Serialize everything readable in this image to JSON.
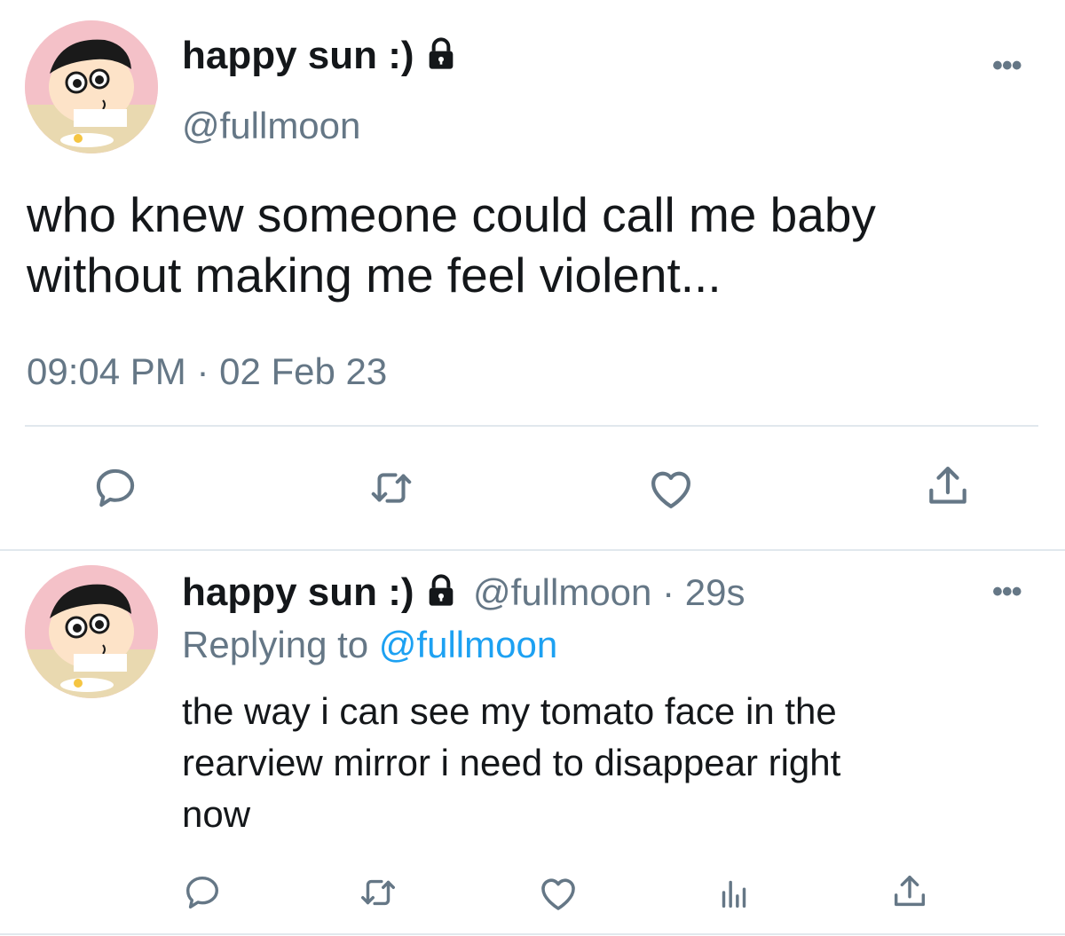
{
  "tweet": {
    "author_name": "happy sun :)",
    "handle": "@fullmoon",
    "text_line1": "who knew someone could call me baby",
    "text_line2": "without making me feel violent...",
    "timestamp": "09:04 PM · 02 Feb 23",
    "more_label": "•••"
  },
  "reply": {
    "author_name": "happy sun :)",
    "handle_time": "@fullmoon · 29s",
    "replying_prefix": "Replying to",
    "replying_to": "@fullmoon",
    "text_line1": "the way i can see my tomato face in the",
    "text_line2": "rearview mirror i need to disappear right",
    "text_line3": "now",
    "more_label": "•••"
  },
  "icons": {
    "reply": "reply-icon",
    "retweet": "retweet-icon",
    "like": "heart-icon",
    "share": "share-icon",
    "analytics": "analytics-icon",
    "lock": "lock-icon"
  },
  "colors": {
    "text": "#14171a",
    "secondary": "#657786",
    "link": "#1da1f2",
    "divider": "#e1e8ed"
  }
}
